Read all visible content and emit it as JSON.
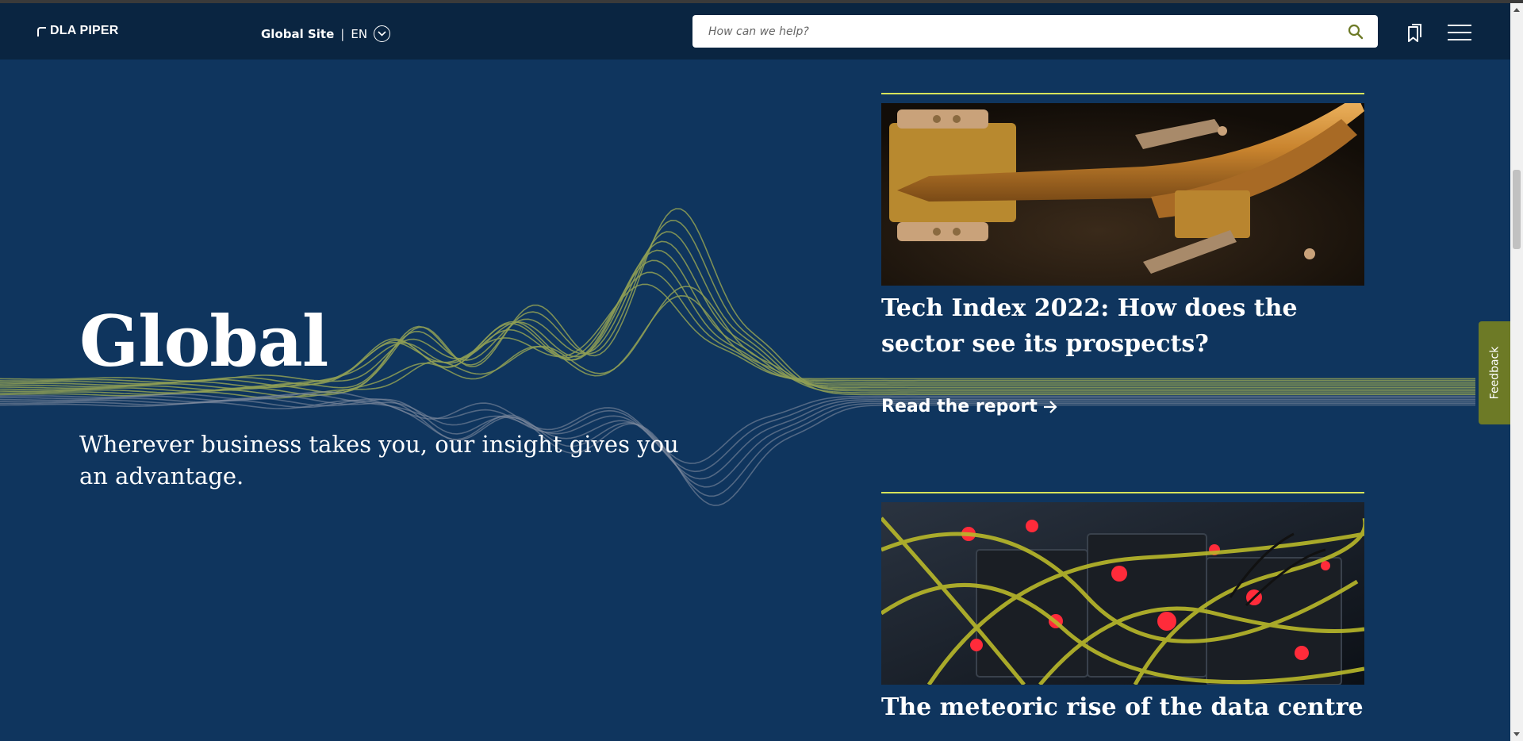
{
  "header": {
    "logo_text": "DLA PIPER",
    "site_label": "Global Site",
    "separator": "|",
    "language": "EN",
    "search_placeholder": "How can we help?",
    "icons": [
      "search-icon",
      "bookmark-icon",
      "hamburger-menu-icon",
      "chevron-down-icon"
    ]
  },
  "hero": {
    "title": "Global",
    "subtitle": "Wherever business takes you, our insight gives you an advantage."
  },
  "cards": [
    {
      "title": "Tech Index 2022: How does the sector see its prospects?",
      "link_label": "Read the report",
      "image_subject": "copper heat pipe on circuit board"
    },
    {
      "title": "The meteoric rise of the data centre",
      "image_subject": "server hardware with yellow cables"
    }
  ],
  "feedback_label": "Feedback",
  "colors": {
    "background": "#0f355e",
    "header": "#0a2541",
    "accent_rule": "#d7e35a",
    "wave_green": "#8f9f55",
    "feedback": "#6d7a26"
  }
}
